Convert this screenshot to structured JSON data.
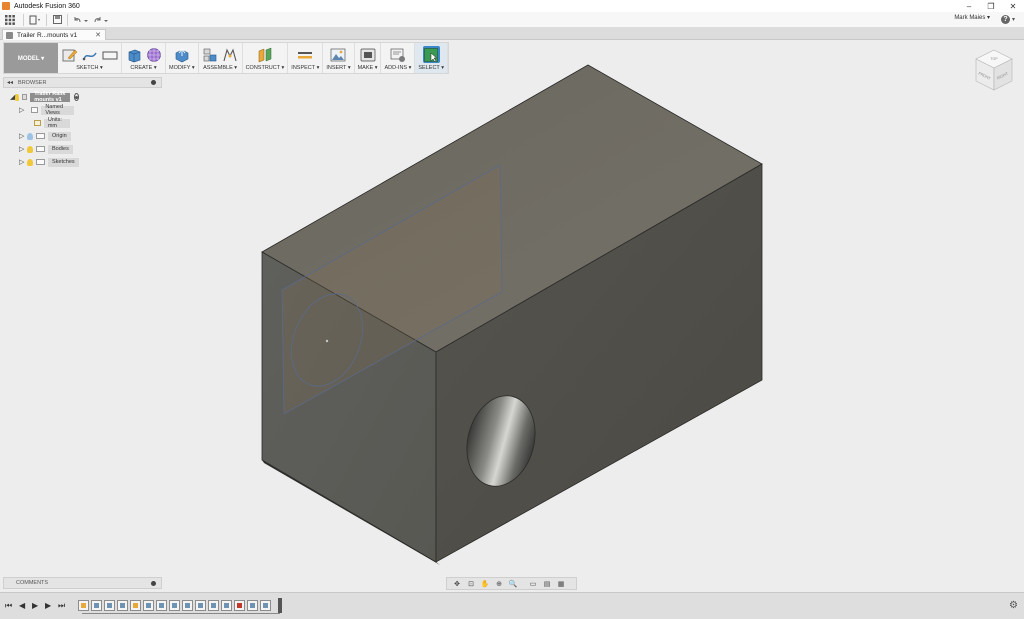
{
  "window": {
    "title": "Autodesk Fusion 360",
    "controls": [
      "–",
      "❐",
      "✕"
    ]
  },
  "qat": {
    "user": "Mark Maies ▾",
    "help": "?"
  },
  "document_tab": {
    "label": "Trailer R...mounts v1",
    "close": "✕"
  },
  "toolbar": {
    "workspace": "MODEL ▾",
    "groups": [
      {
        "label": "SKETCH ▾"
      },
      {
        "label": "CREATE ▾"
      },
      {
        "label": "MODIFY ▾"
      },
      {
        "label": "ASSEMBLE ▾"
      },
      {
        "label": "CONSTRUCT ▾"
      },
      {
        "label": "INSPECT ▾"
      },
      {
        "label": "INSERT ▾"
      },
      {
        "label": "MAKE ▾"
      },
      {
        "label": "ADD-INS ▾"
      },
      {
        "label": "SELECT ▾"
      }
    ]
  },
  "browser": {
    "header": "BROWSER",
    "collapse": "◂◂",
    "root": "Trailer Railk mounts v1",
    "items": [
      {
        "label": "Named Views"
      },
      {
        "label": "Units: mm"
      },
      {
        "label": "Origin"
      },
      {
        "label": "Bodies"
      },
      {
        "label": "Sketches"
      }
    ]
  },
  "comments": {
    "label": "COMMENTS"
  },
  "viewcube": {
    "top": "TOP",
    "front": "FRONT",
    "right": "RIGHT"
  },
  "colors": {
    "body_top": "#6d6a60",
    "body_left": "#5b5a55",
    "body_right": "#4d4b45",
    "sketch_plane": "#7a6a50",
    "select_accent": "#3c86c7"
  },
  "timeline": {
    "controls": [
      "⏮",
      "◀",
      "▶",
      "▶",
      "⏭"
    ],
    "feature_count": 15,
    "gear": "⚙"
  }
}
